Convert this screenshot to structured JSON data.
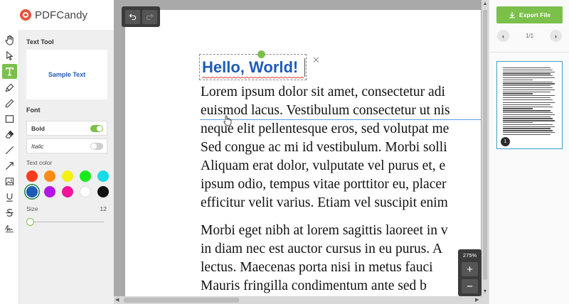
{
  "brand": {
    "name": "PDFCandy"
  },
  "rail": {
    "tools": [
      {
        "name": "hand-icon"
      },
      {
        "name": "select-arrow-icon"
      },
      {
        "name": "text-tool-icon"
      },
      {
        "name": "highlighter-icon"
      },
      {
        "name": "pencil-icon"
      },
      {
        "name": "rectangle-icon"
      },
      {
        "name": "eraser-icon"
      },
      {
        "name": "line-icon"
      },
      {
        "name": "arrow-line-icon"
      },
      {
        "name": "image-icon"
      },
      {
        "name": "underline-icon"
      },
      {
        "name": "strikethrough-icon"
      },
      {
        "name": "signature-icon"
      }
    ],
    "active_tool": "text-tool-icon"
  },
  "panel": {
    "title": "Text Tool",
    "sample_text": "Sample Text",
    "font_title": "Font",
    "bold_label": "Bold",
    "bold_on": true,
    "italic_label": "Italic",
    "italic_on": false,
    "color_label": "Text color",
    "colors": [
      "#ff3b1f",
      "#ff8a14",
      "#f5f10f",
      "#19ea1c",
      "#14dbe8",
      "#1e5bb8",
      "#b514e6",
      "#f2149b",
      "#ffffff",
      "#111111"
    ],
    "selected_color": "#1e5bb8",
    "size_label": "Size",
    "size_value": "12",
    "size_fraction": 0.0
  },
  "toolbar": {
    "undo_icon": "undo-icon",
    "redo_icon": "redo-icon"
  },
  "document": {
    "inserted_text": "Hello, World!",
    "paragraph1": [
      "Lorem ipsum dolor sit amet, consectetur adi",
      "euismod lacus. Vestibulum consectetur ut nis",
      "neque elit pellentesque eros, sed volutpat me",
      "Sed congue ac mi id vestibulum. Morbi solli",
      "Aliquam erat dolor, vulputate vel purus et, e",
      "ipsum odio, tempus vitae porttitor eu, placer",
      "efficitur velit varius. Etiam vel suscipit enim"
    ],
    "paragraph2": [
      "Morbi eget nibh at lorem sagittis laoreet in v",
      "in diam nec est auctor cursus in eu purus. A",
      "lectus. Maecenas porta nisi in metus fauci",
      "Mauris fringilla condimentum ante sed b"
    ]
  },
  "zoom": {
    "level": "275%",
    "plus": "+",
    "minus": "−"
  },
  "sidebar": {
    "export_label": "Export File",
    "page_indicator": "1/1",
    "prev": "‹",
    "next": "›",
    "thumb_page_number": "1"
  }
}
